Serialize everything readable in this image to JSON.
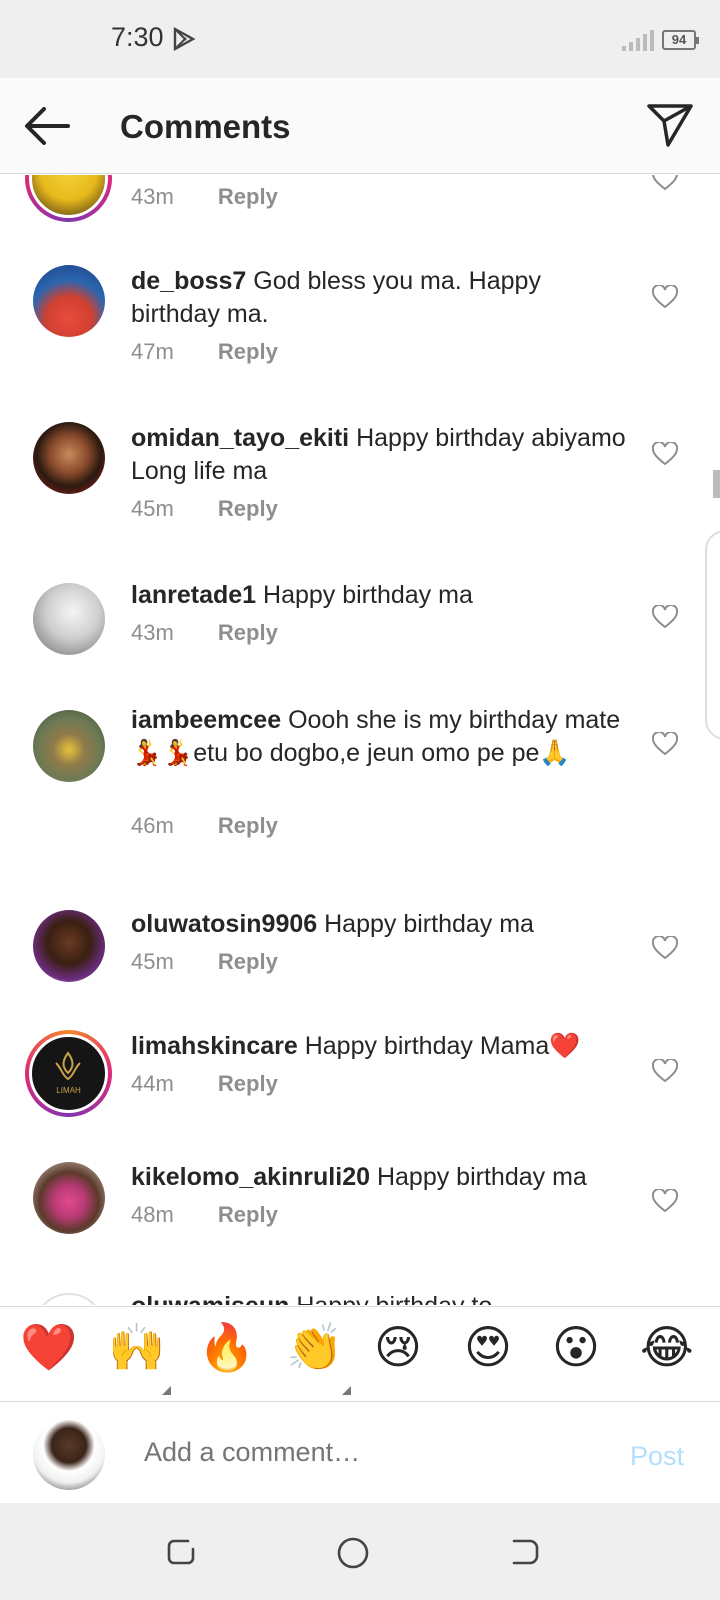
{
  "status_bar": {
    "time": "7:30",
    "battery": "94"
  },
  "header": {
    "title": "Comments"
  },
  "comments": [
    {
      "username": "",
      "text": "",
      "time": "43m",
      "reply": "Reply"
    },
    {
      "username": "de_boss7",
      "text": "God bless you ma. Happy birthday ma.",
      "time": "47m",
      "reply": "Reply"
    },
    {
      "username": "omidan_tayo_ekiti",
      "text": "Happy birthday abiyamo Long life ma",
      "time": "45m",
      "reply": "Reply"
    },
    {
      "username": "lanretade1",
      "text": "Happy birthday ma",
      "time": "43m",
      "reply": "Reply"
    },
    {
      "username": "iambeemcee",
      "text": "Oooh she is my birthday mate💃💃etu bo dogbo,e jeun omo pe pe🙏",
      "time": "46m",
      "reply": "Reply"
    },
    {
      "username": "oluwatosin9906",
      "text": "Happy birthday ma",
      "time": "45m",
      "reply": "Reply"
    },
    {
      "username": "limahskincare",
      "text": "Happy birthday Mama❤️",
      "time": "44m",
      "reply": "Reply"
    },
    {
      "username": "kikelomo_akinruli20",
      "text": "Happy birthday ma",
      "time": "48m",
      "reply": "Reply"
    },
    {
      "username": "oluwamiseun",
      "text": "Happy birthday to",
      "time": "",
      "reply": ""
    }
  ],
  "reactions": [
    "❤️",
    "🙌",
    "🔥",
    "👏",
    "😢",
    "😍",
    "😮",
    "😂"
  ],
  "composer": {
    "placeholder": "Add a comment…",
    "post_label": "Post"
  },
  "logo_text": "LIMAH",
  "colors": {
    "accent_post": "#b2dffc",
    "heart": "#ed4956",
    "username": "#262626",
    "meta": "#8e8e8e"
  }
}
